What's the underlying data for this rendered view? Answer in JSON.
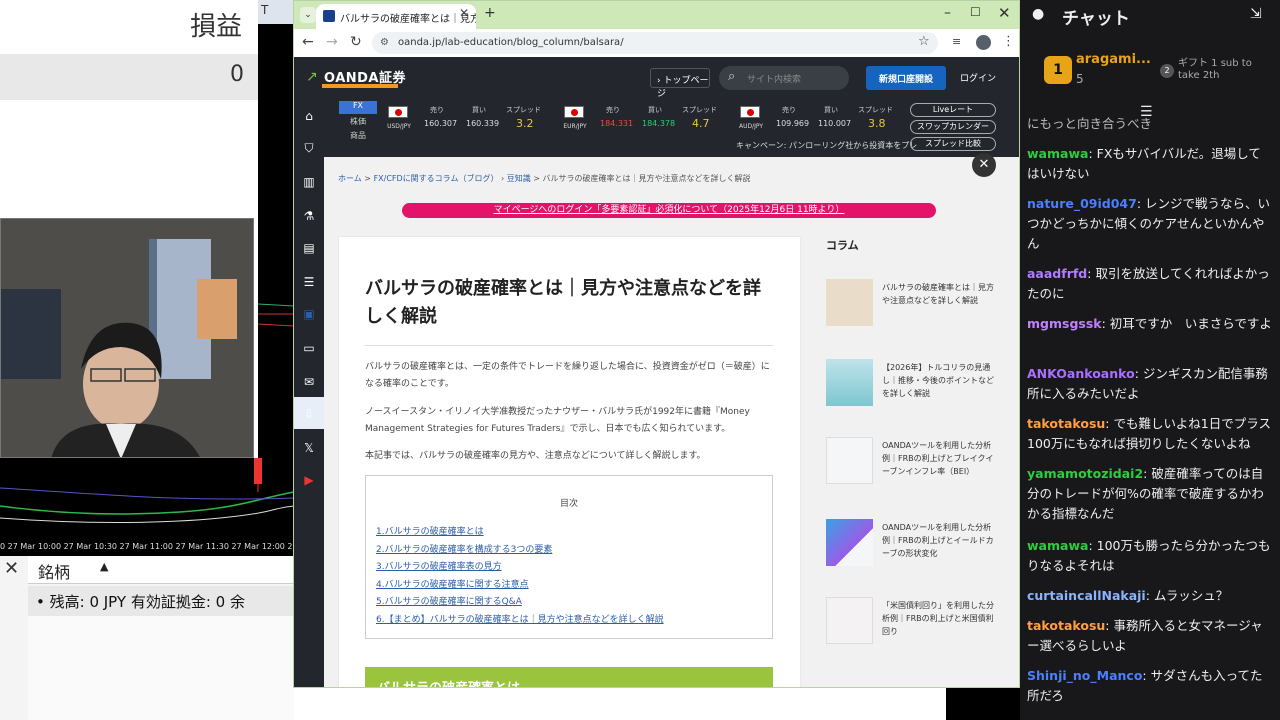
{
  "trade": {
    "pnl_label": "損益",
    "pnl_value": "0",
    "chart_tab": "T",
    "time_axis": "0  27 Mar 10:00  27 Mar 10:30  27 Mar 11:00  27 Mar 11:30  27 Mar 12:00  27 Mar 12:3",
    "column_name": "銘柄",
    "sort_arrow": "▲",
    "close": "✕",
    "balance": "• 残高: 0 JPY  有効証拠金: 0  余"
  },
  "browser": {
    "tab_title": "バルサラの破産確率とは｜見方や",
    "url": "oanda.jp/lab-education/blog_column/balsara/",
    "new_tab": "+",
    "tab_close": "✕"
  },
  "site": {
    "logo": "OANDA証券",
    "btn_top": "› トップページ",
    "search_placeholder": "サイト内検索",
    "btn_open": "新規口座開設",
    "btn_login": "ログイン",
    "rate_tabs": [
      "FX",
      "株価",
      "商品"
    ],
    "rates": [
      {
        "pair": "USD/JPY",
        "sell": "160.307",
        "buy": "160.339",
        "spread": "3.2"
      },
      {
        "pair": "EUR/JPY",
        "sell": "184.331",
        "buy": "184.378",
        "spread": "4.7"
      },
      {
        "pair": "AUD/JPY",
        "sell": "109.969",
        "buy": "110.007",
        "spread": "3.8"
      }
    ],
    "rate_labels": {
      "sell": "売り",
      "buy": "買い",
      "spread": "スプレッド"
    },
    "campaign": "キャンペーン:  パンローリング社から投資本をプレ",
    "rate_buttons": [
      "Liveレート",
      "スワップカレンダー",
      "スプレッド比較"
    ],
    "breadcrumb": {
      "home": "ホーム",
      "c1": "FX/CFDに関するコラム（ブログ）",
      "c2": "豆知識",
      "current": "バルサラの破産確率とは｜見方や注意点などを詳しく解説"
    },
    "notice": "マイページへのログイン「多要素認証」必須化について（2025年12月6日 11時より）",
    "article": {
      "title": "バルサラの破産確率とは｜見方や注意点などを詳しく解説",
      "p1": "バルサラの破産確率とは、一定の条件でトレードを繰り返した場合に、投資資金がゼロ（＝破産）になる確率のことです。",
      "p2": "ノースイースタン・イリノイ大学准教授だったナウザー・バルサラ氏が1992年に書籍『Money Management Strategies for Futures Traders』で示し、日本でも広く知られています。",
      "p3": "本記事では、バルサラの破産確率の見方や、注意点などについて詳しく解説します。",
      "toc_title": "目次",
      "toc": [
        "1.バルサラの破産確率とは",
        "2.バルサラの破産確率を構成する3つの要素",
        "3.バルサラの破産確率表の見方",
        "4.バルサラの破産確率に関する注意点",
        "5.バルサラの破産確率に関するQ&A",
        "6.【まとめ】バルサラの破産確率とは｜見方や注意点などを詳しく解説"
      ],
      "section_heading": "バルサラの破産確率とは"
    },
    "column_heading": "コラム",
    "columns": [
      "バルサラの破産確率とは｜見方や注意点などを詳しく解説",
      "【2026年】トルコリラの見通し｜推移・今後のポイントなどを詳しく解説",
      "OANDAツールを利用した分析例｜FRBの利上げとブレイクイーブンインフレ率（BEI）",
      "OANDAツールを利用した分析例｜FRBの利上げとイールドカーブの形状変化",
      "「米国債利回り」を利用した分析例｜FRBの利上げと米国債利回り"
    ]
  },
  "chat": {
    "title": "チャット",
    "top_user": "aragami...",
    "top_count": "5",
    "badge": "1",
    "gift_rank": "2",
    "gift_text": "ギフト 1 sub to take 2th",
    "partial": "にもっと向き合うべき",
    "messages": [
      {
        "user": "wamawa",
        "color": "#2ecc40",
        "text": "FXもサバイバルだ。退場してはいけない"
      },
      {
        "user": "nature_09id047",
        "color": "#4a7fff",
        "text": "レンジで戦うなら、いつかどっちかに傾くのケアせんといかんやん"
      },
      {
        "user": "aaadfrfd",
        "color": "#b07cff",
        "text": "取引を放送してくれればよかったのに"
      },
      {
        "user": "mgmsgssk",
        "color": "#c080ff",
        "text": "初耳ですか　いまさらですよ"
      },
      {
        "user": "ANKOankoanko",
        "color": "#a970ff",
        "text": "ジンギスカン配信事務所に入るみたいだよ"
      },
      {
        "user": "takotakosu",
        "color": "#ff9f43",
        "text": "でも難しいよね1日でプラス100万にもなれば損切りしたくないよね"
      },
      {
        "user": "yamamotozidai2",
        "color": "#2ecc40",
        "text": "破産確率ってのは自分のトレードが何%の確率で破産するかわかる指標なんだ"
      },
      {
        "user": "wamawa",
        "color": "#2ecc40",
        "text": "100万も勝ったら分かったつもりなるよそれは"
      },
      {
        "user": "curtaincallNakaji",
        "color": "#8ab4ff",
        "text": "ムラッシュ？"
      },
      {
        "user": "takotakosu",
        "color": "#ff9f43",
        "text": "事務所入ると女マネージャー選べるらしいよ"
      },
      {
        "user": "Shinji_no_Manco",
        "color": "#4a7fff",
        "text": "サダさんも入ってた所だろ"
      }
    ]
  }
}
